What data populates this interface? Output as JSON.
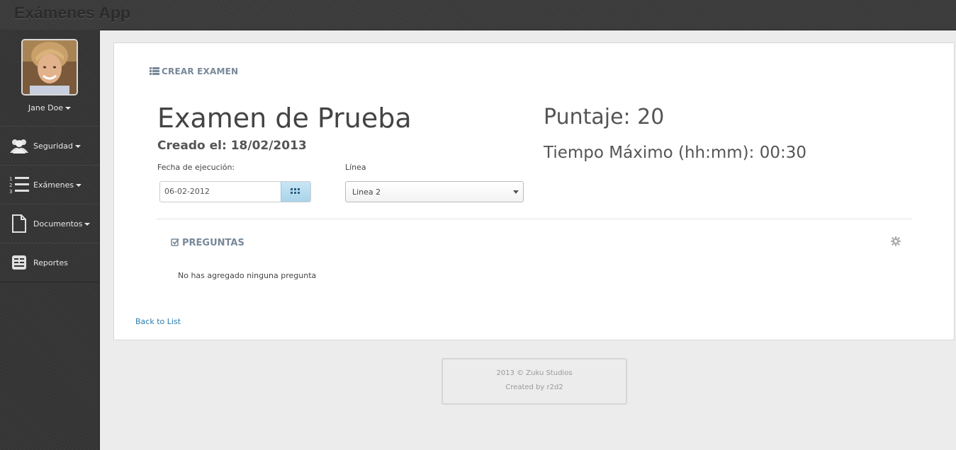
{
  "app": {
    "title": "Exámenes App"
  },
  "user": {
    "name": "Jane Doe"
  },
  "sidebar": {
    "items": [
      {
        "label": "Seguridad",
        "icon": "users-icon",
        "has_dropdown": true
      },
      {
        "label": "Exámenes",
        "icon": "ordered-list-icon",
        "has_dropdown": true
      },
      {
        "label": "Documentos",
        "icon": "document-icon",
        "has_dropdown": true
      },
      {
        "label": "Reportes",
        "icon": "report-icon",
        "has_dropdown": false
      }
    ]
  },
  "panel": {
    "heading": "CREAR EXAMEN",
    "exam_title": "Examen de Prueba",
    "created": "Creado el: 18/02/2013",
    "date_label": "Fecha de ejecución:",
    "date_value": "06-02-2012",
    "line_label": "Línea",
    "line_value": "Linea 2",
    "score": "Puntaje: 20",
    "max_time": "Tiempo Máximo (hh:mm): 00:30",
    "questions_heading": "PREGUNTAS",
    "questions_empty": "No has agregado ninguna pregunta",
    "back_link": "Back to List"
  },
  "footer": {
    "line1": "2013 © Zuku Studios",
    "line2": "Created by r2d2"
  },
  "colors": {
    "link": "#2a7ab0",
    "heading": "#778899",
    "sidebar": "#333333",
    "calendar_button": "#a9d3ea"
  }
}
